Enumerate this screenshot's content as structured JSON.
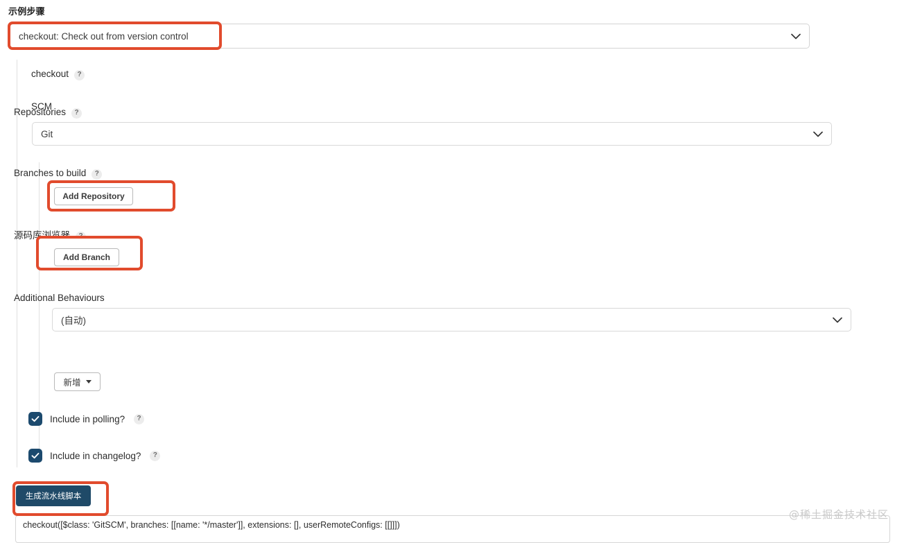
{
  "page": {
    "section_title": "示例步骤",
    "watermark": "@稀土掘金技术社区"
  },
  "step_selector": {
    "value": "checkout: Check out from version control",
    "chevron_icon": "chevron-down-icon"
  },
  "step_panel": {
    "title": "checkout",
    "title_help": "?",
    "scm": {
      "label": "SCM",
      "value": "Git",
      "chevron_icon": "chevron-down-icon"
    },
    "repositories": {
      "label": "Repositories",
      "help": "?",
      "add_button": "Add Repository"
    },
    "branches": {
      "label": "Branches to build",
      "help": "?",
      "add_button": "Add Branch"
    },
    "browser": {
      "label": "源码库浏览器",
      "help": "?",
      "value": "(自动)",
      "chevron_icon": "chevron-down-icon"
    },
    "additional_behaviours": {
      "label": "Additional Behaviours",
      "add_button": "新增",
      "caret_icon": "caret-down-icon"
    },
    "checkboxes": [
      {
        "label": "Include in polling?",
        "help": "?",
        "checked": true
      },
      {
        "label": "Include in changelog?",
        "help": "?",
        "checked": true
      }
    ]
  },
  "footer": {
    "generate_button": "生成流水线脚本",
    "generated_code": "checkout([$class: 'GitSCM', branches: [[name: '*/master']], extensions: [], userRemoteConfigs: [[]]])"
  },
  "colors": {
    "annotation_red": "#e14b2d",
    "primary_blue": "#1f4a68",
    "checkbox_blue": "#1c4a6e"
  }
}
